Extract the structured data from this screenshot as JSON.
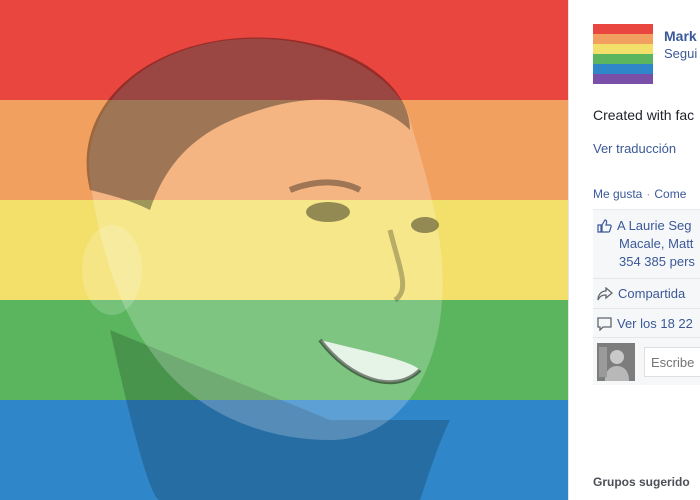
{
  "photo": {
    "stripe_colors": [
      "#e8463e",
      "#f2a060",
      "#f3e06a",
      "#5ab55e",
      "#2f86c9"
    ]
  },
  "post": {
    "author_name": "Mark",
    "follow_label": "Segui",
    "caption": "Created with fac",
    "translate_label": "Ver traducción",
    "actions": [
      "Me gusta",
      "Come"
    ],
    "likes_lines": [
      "A Laurie Seg",
      "Macale, Matt",
      "354 385 pers"
    ],
    "shared_label": "Compartida",
    "comments_label": "Ver los 18 22",
    "comment_placeholder": "Escribe"
  },
  "sidebar": {
    "suggested_groups_label": "Grupos sugerido"
  },
  "colors": {
    "link_blue": "#3b5998"
  }
}
